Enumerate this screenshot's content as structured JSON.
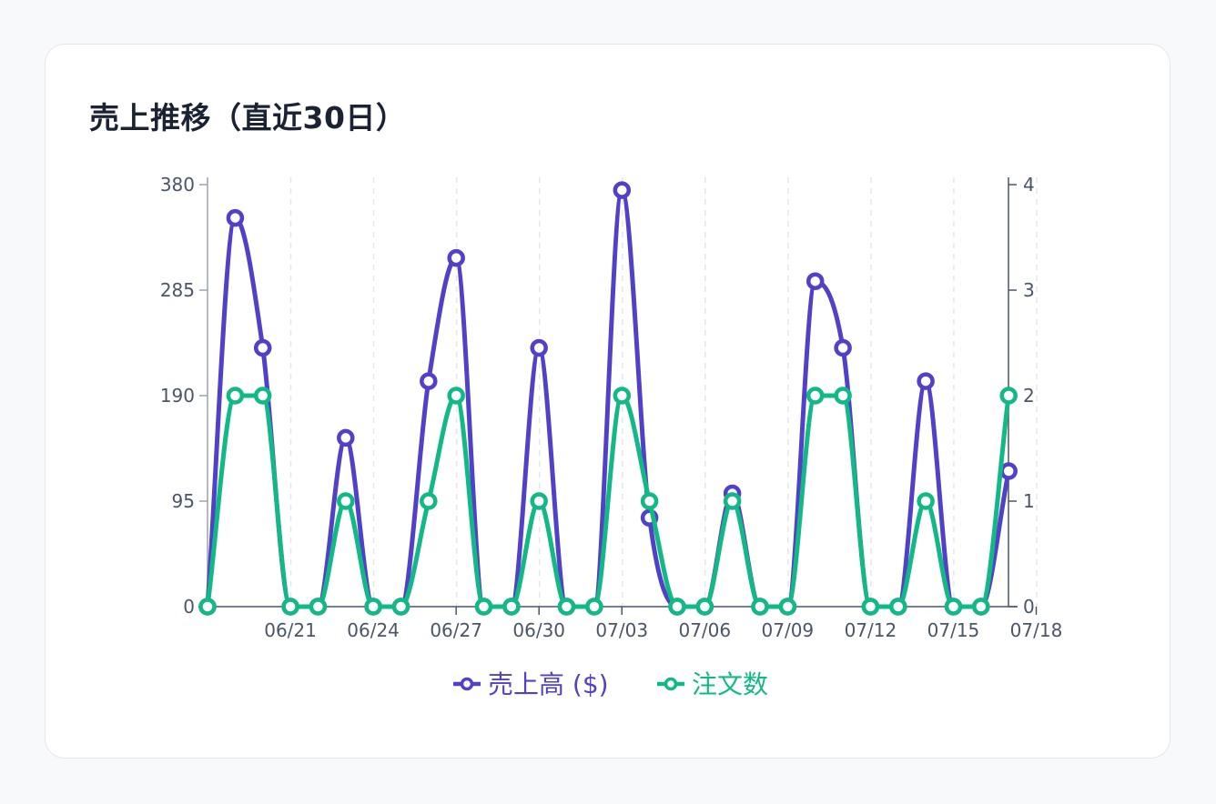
{
  "card": {
    "title": "売上推移（直近30日）"
  },
  "chart_data": {
    "type": "line",
    "title": "売上推移（直近30日）",
    "x": [
      "06/18",
      "06/19",
      "06/20",
      "06/21",
      "06/22",
      "06/23",
      "06/24",
      "06/25",
      "06/26",
      "06/27",
      "06/28",
      "06/29",
      "06/30",
      "07/01",
      "07/02",
      "07/03",
      "07/04",
      "07/05",
      "07/06",
      "07/07",
      "07/08",
      "07/09",
      "07/10",
      "07/11",
      "07/12",
      "07/13",
      "07/14",
      "07/15",
      "07/16",
      "07/17",
      "07/18"
    ],
    "x_tick_labels": [
      "06/21",
      "06/24",
      "06/27",
      "06/30",
      "07/03",
      "07/06",
      "07/09",
      "07/12",
      "07/15",
      "07/18"
    ],
    "y_left": {
      "ticks": [
        "0",
        "95",
        "190",
        "285",
        "380"
      ],
      "ylim": [
        0,
        380
      ]
    },
    "y_right": {
      "ticks": [
        "0",
        "1",
        "2",
        "3",
        "4"
      ],
      "ylim": [
        0,
        4
      ]
    },
    "grid": "vertical-dashed",
    "legend_position": "bottom",
    "series": [
      {
        "name": "売上高 ($)",
        "axis": "left",
        "color": "#5140c8",
        "values": [
          0,
          350,
          233,
          0,
          0,
          152,
          0,
          0,
          203,
          314,
          0,
          0,
          233,
          0,
          0,
          375,
          80,
          0,
          0,
          102,
          0,
          0,
          293,
          233,
          0,
          0,
          203,
          0,
          0,
          122
        ]
      },
      {
        "name": "注文数",
        "axis": "right",
        "color": "#12b886",
        "values": [
          0,
          2,
          2,
          0,
          0,
          1,
          0,
          0,
          1,
          2,
          0,
          0,
          1,
          0,
          0,
          2,
          1,
          0,
          0,
          1,
          0,
          0,
          2,
          2,
          0,
          0,
          1,
          0,
          0,
          2
        ]
      }
    ]
  }
}
